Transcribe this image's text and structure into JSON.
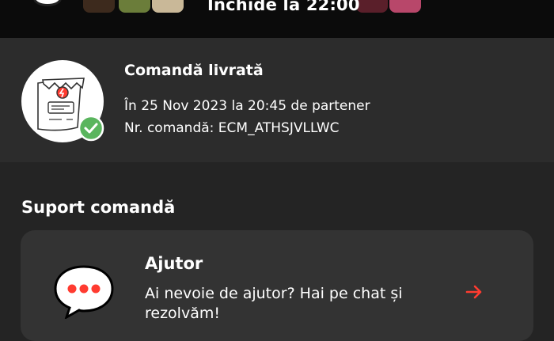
{
  "header": {
    "closing_text": "Închide la 22:00"
  },
  "order": {
    "status": "Comandă livrată",
    "delivered_line": "În 25 Nov 2023 la 20:45 de partener",
    "order_number_line": "Nr. comandă: ECM_ATHSJVLLWC",
    "icons": [
      "receipt-icon",
      "checkmark-icon"
    ]
  },
  "support": {
    "title": "Suport comandă",
    "help": {
      "title": "Ajutor",
      "description": "Ai nevoie de ajutor? Hai pe chat și rezolvăm!",
      "icons": [
        "chat-bubble-icon",
        "arrow-right-icon"
      ],
      "accent_color": "#ff3b30"
    }
  }
}
